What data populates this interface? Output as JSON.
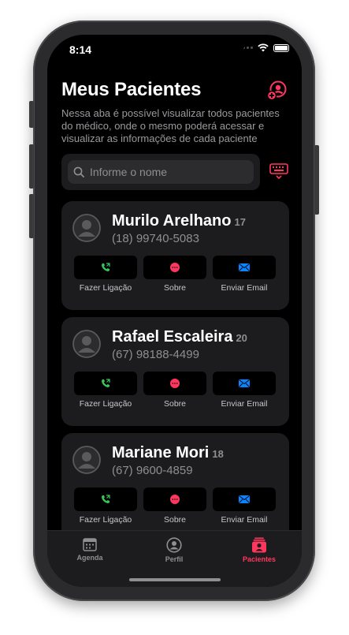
{
  "status_bar": {
    "time": "8:14"
  },
  "header": {
    "title": "Meus Pacientes",
    "description": "Nessa aba é possível visualizar todos pacientes do médico, onde o mesmo poderá acessar e visualizar as informações de cada paciente",
    "add_icon": "add-user-icon"
  },
  "search": {
    "placeholder": "Informe o nome",
    "value": ""
  },
  "patients": [
    {
      "name": "Murilo Arelhano",
      "age": "17",
      "phone": "(18) 99740-5083"
    },
    {
      "name": "Rafael Escaleira",
      "age": "20",
      "phone": "(67) 98188-4499"
    },
    {
      "name": "Mariane Mori",
      "age": "18",
      "phone": "(67) 9600-4859"
    }
  ],
  "actions": {
    "call": "Fazer Ligação",
    "about": "Sobre",
    "email": "Enviar Email"
  },
  "tabs": [
    {
      "label": "Agenda",
      "icon": "calendar-icon",
      "active": false
    },
    {
      "label": "Perfil",
      "icon": "profile-icon",
      "active": false
    },
    {
      "label": "Pacientes",
      "icon": "patients-icon",
      "active": true
    }
  ],
  "colors": {
    "accent": "#ff375f",
    "call": "#34c759",
    "email": "#0a84ff",
    "inactive": "#8e8e93"
  }
}
